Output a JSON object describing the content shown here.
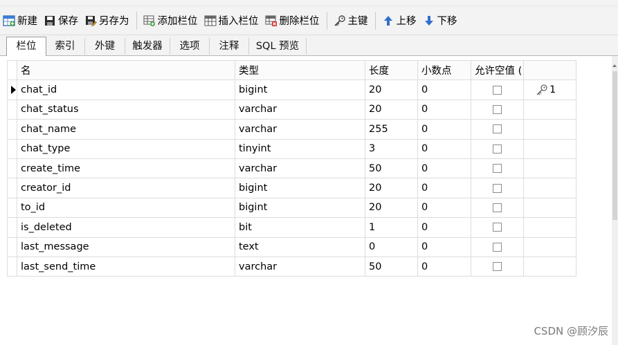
{
  "toolbar": {
    "new_label": "新建",
    "save_label": "保存",
    "save_as_label": "另存为",
    "add_column_label": "添加栏位",
    "insert_column_label": "插入栏位",
    "delete_column_label": "删除栏位",
    "primary_key_label": "主键",
    "move_up_label": "上移",
    "move_down_label": "下移"
  },
  "tabs": [
    {
      "label": "栏位",
      "active": true
    },
    {
      "label": "索引"
    },
    {
      "label": "外键"
    },
    {
      "label": "触发器"
    },
    {
      "label": "选项"
    },
    {
      "label": "注释"
    },
    {
      "label": "SQL 预览"
    }
  ],
  "grid": {
    "headers": [
      "名",
      "类型",
      "长度",
      "小数点",
      "允许空值 (",
      ""
    ],
    "rows": [
      {
        "name": "chat_id",
        "type": "bigint",
        "length": "20",
        "decimals": "0",
        "key": "1"
      },
      {
        "name": "chat_status",
        "type": "varchar",
        "length": "20",
        "decimals": "0",
        "key": ""
      },
      {
        "name": "chat_name",
        "type": "varchar",
        "length": "255",
        "decimals": "0",
        "key": ""
      },
      {
        "name": "chat_type",
        "type": "tinyint",
        "length": "3",
        "decimals": "0",
        "key": ""
      },
      {
        "name": "create_time",
        "type": "varchar",
        "length": "50",
        "decimals": "0",
        "key": ""
      },
      {
        "name": "creator_id",
        "type": "bigint",
        "length": "20",
        "decimals": "0",
        "key": ""
      },
      {
        "name": "to_id",
        "type": "bigint",
        "length": "20",
        "decimals": "0",
        "key": ""
      },
      {
        "name": "is_deleted",
        "type": "bit",
        "length": "1",
        "decimals": "0",
        "key": ""
      },
      {
        "name": "last_message",
        "type": "text",
        "length": "0",
        "decimals": "0",
        "key": ""
      },
      {
        "name": "last_send_time",
        "type": "varchar",
        "length": "50",
        "decimals": "0",
        "key": ""
      }
    ]
  },
  "watermark": "CSDN @顾汐辰"
}
